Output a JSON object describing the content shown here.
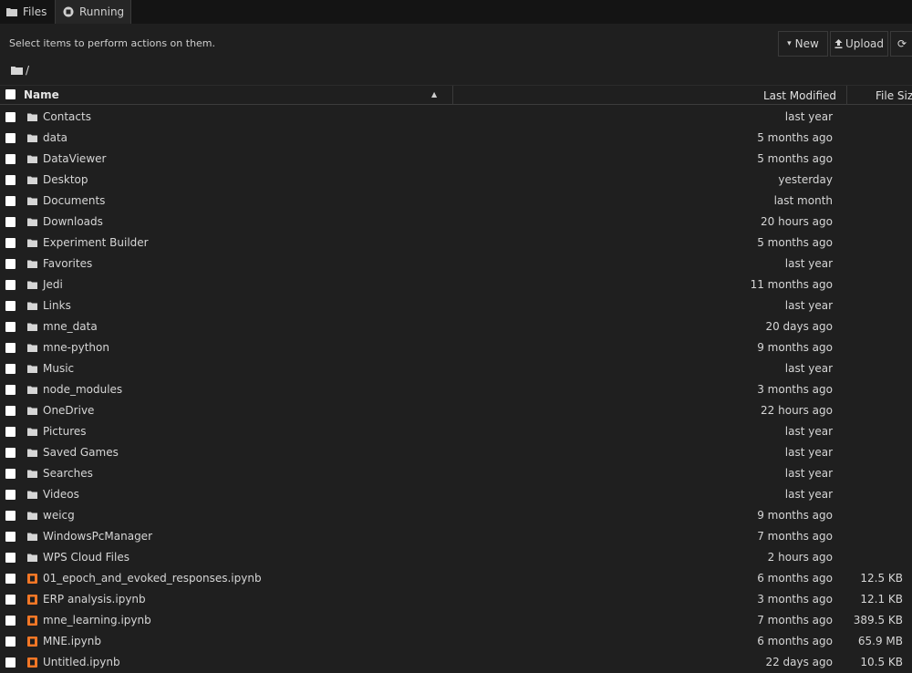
{
  "tabs": [
    {
      "label": "Files",
      "icon": "folder-icon"
    },
    {
      "label": "Running",
      "icon": "running-icon"
    }
  ],
  "toolbar": {
    "selection_hint": "Select items to perform actions on them.",
    "new_label": "New",
    "upload_label": "Upload",
    "refresh_glyph": "⟳"
  },
  "breadcrumb": {
    "path": "/"
  },
  "table": {
    "headers": {
      "name": "Name",
      "modified": "Last Modified",
      "size": "File Size"
    },
    "rows": [
      {
        "name": "Contacts",
        "type": "folder",
        "modified": "last year",
        "size": ""
      },
      {
        "name": "data",
        "type": "folder",
        "modified": "5 months ago",
        "size": ""
      },
      {
        "name": "DataViewer",
        "type": "folder",
        "modified": "5 months ago",
        "size": ""
      },
      {
        "name": "Desktop",
        "type": "folder",
        "modified": "yesterday",
        "size": ""
      },
      {
        "name": "Documents",
        "type": "folder",
        "modified": "last month",
        "size": ""
      },
      {
        "name": "Downloads",
        "type": "folder",
        "modified": "20 hours ago",
        "size": ""
      },
      {
        "name": "Experiment Builder",
        "type": "folder",
        "modified": "5 months ago",
        "size": ""
      },
      {
        "name": "Favorites",
        "type": "folder",
        "modified": "last year",
        "size": ""
      },
      {
        "name": "Jedi",
        "type": "folder",
        "modified": "11 months ago",
        "size": ""
      },
      {
        "name": "Links",
        "type": "folder",
        "modified": "last year",
        "size": ""
      },
      {
        "name": "mne_data",
        "type": "folder",
        "modified": "20 days ago",
        "size": ""
      },
      {
        "name": "mne-python",
        "type": "folder",
        "modified": "9 months ago",
        "size": ""
      },
      {
        "name": "Music",
        "type": "folder",
        "modified": "last year",
        "size": ""
      },
      {
        "name": "node_modules",
        "type": "folder",
        "modified": "3 months ago",
        "size": ""
      },
      {
        "name": "OneDrive",
        "type": "folder",
        "modified": "22 hours ago",
        "size": ""
      },
      {
        "name": "Pictures",
        "type": "folder",
        "modified": "last year",
        "size": ""
      },
      {
        "name": "Saved Games",
        "type": "folder",
        "modified": "last year",
        "size": ""
      },
      {
        "name": "Searches",
        "type": "folder",
        "modified": "last year",
        "size": ""
      },
      {
        "name": "Videos",
        "type": "folder",
        "modified": "last year",
        "size": ""
      },
      {
        "name": "weicg",
        "type": "folder",
        "modified": "9 months ago",
        "size": ""
      },
      {
        "name": "WindowsPcManager",
        "type": "folder",
        "modified": "7 months ago",
        "size": ""
      },
      {
        "name": "WPS Cloud Files",
        "type": "folder",
        "modified": "2 hours ago",
        "size": ""
      },
      {
        "name": "01_epoch_and_evoked_responses.ipynb",
        "type": "notebook",
        "modified": "6 months ago",
        "size": "12.5 KB"
      },
      {
        "name": "ERP analysis.ipynb",
        "type": "notebook",
        "modified": "3 months ago",
        "size": "12.1 KB"
      },
      {
        "name": "mne_learning.ipynb",
        "type": "notebook",
        "modified": "7 months ago",
        "size": "389.5 KB"
      },
      {
        "name": "MNE.ipynb",
        "type": "notebook",
        "modified": "6 months ago",
        "size": "65.9 MB"
      },
      {
        "name": "Untitled.ipynb",
        "type": "notebook",
        "modified": "22 days ago",
        "size": "10.5 KB"
      }
    ]
  },
  "colors": {
    "background": "#1f1f1f",
    "notebook_icon": "#f37726",
    "text": "#d6d6d6"
  }
}
